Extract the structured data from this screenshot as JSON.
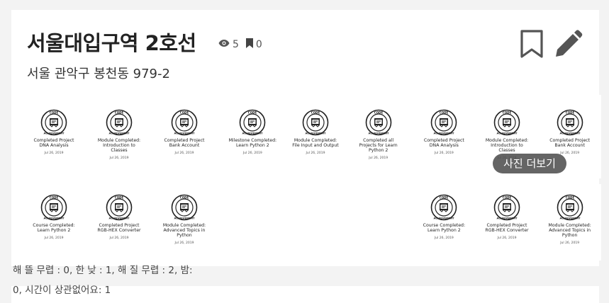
{
  "place": {
    "title": "서울대입구역 2호선",
    "address": "서울 관악구 봉천동 979-2",
    "views": "5",
    "bookmarks": "0"
  },
  "icons": {
    "views": "eye-icon",
    "bookmarks": "bookmark-icon",
    "bookmark_action": "bookmark-outline-icon",
    "edit_action": "pencil-icon"
  },
  "photos": {
    "more_label": "사진 더보기",
    "group1": [
      {
        "title": "Completed Project\nDNA Analysis",
        "date": "Jul 26, 2019"
      },
      {
        "title": "Module Completed:\nIntroduction to\nClasses",
        "date": "Jul 26, 2019"
      },
      {
        "title": "Completed Project\nBank Account",
        "date": "Jul 26, 2019"
      }
    ],
    "group2": [
      {
        "title": "Milestone Completed:\nLearn Python 2",
        "date": "Jul 26, 2019"
      },
      {
        "title": "Module Completed:\nFile Input and Output",
        "date": "Jul 26, 2019"
      },
      {
        "title": "Completed all\nProjects for Learn\nPython 2",
        "date": "Jul 26, 2019"
      }
    ],
    "group3": [
      {
        "title": "Completed Project\nDNA Analysis",
        "date": "Jul 26, 2019"
      },
      {
        "title": "Module Completed:\nIntroduction to\nClasses",
        "date": "Jul 26, 2019"
      },
      {
        "title": "Completed Project\nBank Account",
        "date": "Jul 26, 2019"
      }
    ],
    "group4": [
      {
        "title": "Course Completed:\nLearn Python 2",
        "date": "Jul 26, 2019"
      },
      {
        "title": "Completed Project\nRGB-HEX Converter",
        "date": "Jul 26, 2019"
      },
      {
        "title": "Module Completed:\nAdvanced Topics in\nPython",
        "date": "Jul 26, 2019"
      }
    ],
    "group5": [
      {
        "title": "Course Completed:\nLearn Python 2",
        "date": "Jul 26, 2019"
      },
      {
        "title": "Completed Project\nRGB-HEX Converter",
        "date": "Jul 26, 2019"
      },
      {
        "title": "Module Completed:\nAdvanced Topics in\nPython",
        "date": "Jul 26, 2019"
      }
    ]
  },
  "badge": {
    "top_text": "CODE",
    "bottom_text": "ACHIEVEMENT"
  },
  "operations": "해 뜰 무렵 : 0, 한 낮 : 1, 해 질 무렵 : 2, 밤: 0, 시간이 상관없어요: 1"
}
